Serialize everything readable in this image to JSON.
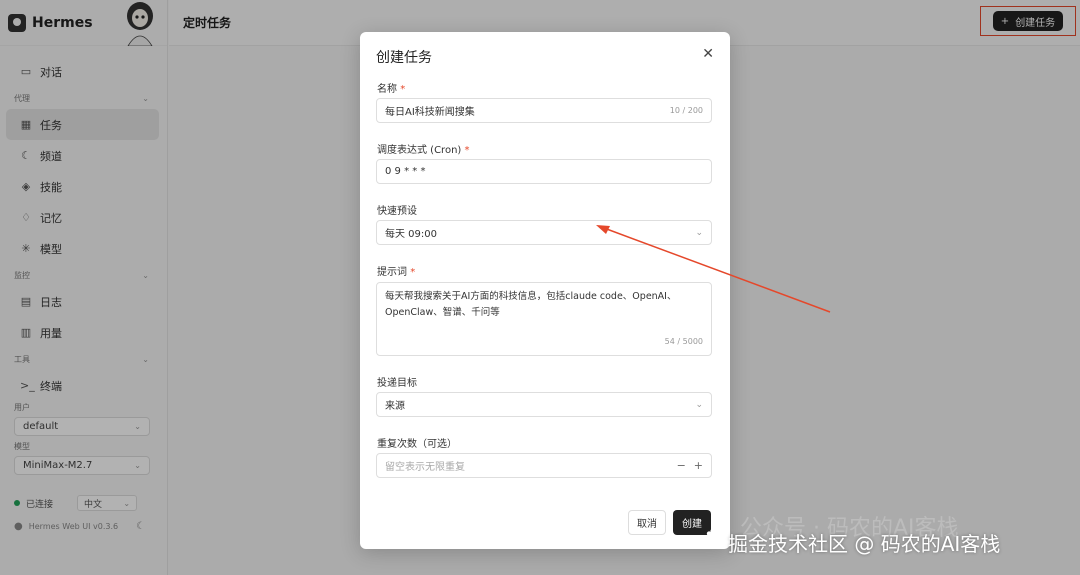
{
  "app": {
    "name": "Hermes"
  },
  "sidebar": {
    "nav_chat": "对话",
    "section_agent": "代理",
    "nav_tasks": "任务",
    "nav_channels": "频道",
    "nav_skills": "技能",
    "nav_memory": "记忆",
    "nav_models": "模型",
    "section_monitor": "监控",
    "nav_logs": "日志",
    "nav_usage": "用量",
    "section_tools": "工具",
    "nav_terminal": "终端",
    "user_label": "用户",
    "user_value": "default",
    "model_label": "模型",
    "model_value": "MiniMax-M2.7",
    "status": "已连接",
    "language": "中文",
    "version": "Hermes Web UI v0.3.6"
  },
  "header": {
    "title": "定时任务",
    "create_button": "创建任务"
  },
  "modal": {
    "title": "创建任务",
    "name_label": "名称",
    "name_value": "每日AI科技新闻搜集",
    "name_counter": "10 / 200",
    "cron_label": "调度表达式 (Cron)",
    "cron_value": "0 9 * * *",
    "preset_label": "快速预设",
    "preset_value": "每天 09:00",
    "prompt_label": "提示词",
    "prompt_value": "每天帮我搜索关于AI方面的科技信息，包括claude code、OpenAI、OpenClaw、智谱、千问等",
    "prompt_counter": "54 / 5000",
    "target_label": "投递目标",
    "target_value": "来源",
    "repeat_label": "重复次数（可选）",
    "repeat_placeholder": "留空表示无限重复",
    "cancel_button": "取消",
    "create_button": "创建",
    "required_mark": "*"
  },
  "watermark": {
    "faded": "公众号 · 码农的AI客栈",
    "text": "掘金技术社区 @ 码农的AI客栈"
  },
  "colors": {
    "accent": "#e5482b",
    "primary": "#222222",
    "status_online": "#22a35a"
  }
}
